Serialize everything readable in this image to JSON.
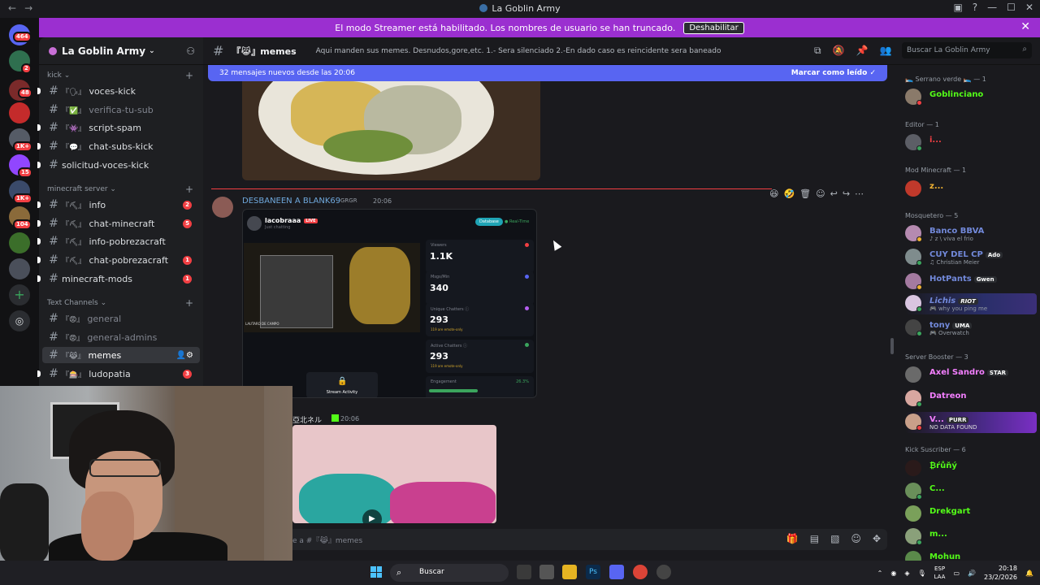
{
  "window": {
    "title": "La Goblin Army",
    "back_icon": "←",
    "forward_icon": "→"
  },
  "servers": {
    "badges": [
      "464",
      "2",
      "48",
      "1K+",
      "15",
      "1K+",
      "104"
    ]
  },
  "banner": {
    "text": "El modo Streamer está habilitado. Los nombres de usuario se han truncado.",
    "button": "Deshabilitar"
  },
  "sidebar": {
    "server_name": "La Goblin Army",
    "categories": {
      "kick": "kick",
      "minecraft": "minecraft server",
      "text": "Text Channels"
    },
    "channels": [
      {
        "emoji": "『🗣』",
        "label": "voces-kick",
        "count": ""
      },
      {
        "emoji": "『✅』",
        "label": "verifica-tu-sub",
        "count": ""
      },
      {
        "emoji": "『👾』",
        "label": "script-spam",
        "count": ""
      },
      {
        "emoji": "『💬』",
        "label": "chat-subs-kick",
        "count": ""
      },
      {
        "emoji": "",
        "label": "solicitud-voces-kick",
        "count": ""
      },
      {
        "emoji": "『⛏』",
        "label": "info",
        "count": "2"
      },
      {
        "emoji": "『⛏』",
        "label": "chat-minecraft",
        "count": "5"
      },
      {
        "emoji": "『⛏』",
        "label": "info-pobrezacraft",
        "count": ""
      },
      {
        "emoji": "『⛏』",
        "label": "chat-pobrezacraft",
        "count": "1"
      },
      {
        "emoji": "",
        "label": "minecraft-mods",
        "count": "1"
      },
      {
        "emoji": "『😡』",
        "label": "general",
        "count": ""
      },
      {
        "emoji": "『😡』",
        "label": "general-admins",
        "count": ""
      },
      {
        "emoji": "『😹』",
        "label": "memes",
        "count": ""
      },
      {
        "emoji": "『🎰』",
        "label": "ludopatia",
        "count": "3"
      }
    ]
  },
  "header": {
    "channel": "『😹』memes",
    "topic": "Aqui manden sus memes. Desnudos,gore,etc. 1.- Sera silenciado 2.-En dado caso es reincidente sera baneado",
    "search_placeholder": "Buscar La Goblin Army"
  },
  "chat": {
    "new_messages": "32 mensajes nuevos desde las 20:06",
    "mark_read": "Marcar como leído",
    "message1": {
      "author": "DESBANEEN A BLANK69",
      "tag": "GRGR",
      "time": "20:06"
    },
    "dashboard": {
      "username": "lacobraaa",
      "live": "LIVE",
      "status": "Just chatting",
      "pill1": "Database",
      "pill2": "● Real-Time",
      "video_caption": "LAUTARO DE CAMPO",
      "stats": [
        {
          "label": "Viewers",
          "value": "1.1K",
          "note": "",
          "color": "#f23f43"
        },
        {
          "label": "Msgs/Min",
          "value": "340",
          "note": "",
          "color": "#5865f2"
        },
        {
          "label": "Unique Chatters ⓘ",
          "value": "293",
          "note": "119 are emote-only",
          "color": "#b45ef0"
        },
        {
          "label": "Active Chatters ⓘ",
          "value": "293",
          "note": "119 are emote-only",
          "color": "#3ba55d"
        }
      ],
      "engagement_label": "Engagement",
      "engagement_value": "26.3%",
      "stream_activity": "Stream Activity"
    },
    "message2": {
      "author": "亞北ネル",
      "time": "20:06"
    },
    "composer_placeholder": "e a #『😹』memes"
  },
  "members": {
    "groups": [
      {
        "name": "🛌 Serrano verde 🛌 — 1"
      },
      {
        "name": "Editor — 1"
      },
      {
        "name": "Mod Minecraft — 1"
      },
      {
        "name": "Mosquetero — 5"
      },
      {
        "name": "Server Booster — 3"
      },
      {
        "name": "Kick Suscriber — 6"
      }
    ],
    "list": [
      {
        "name": "Goblinciano",
        "activity": "",
        "tag": "",
        "color": "#3ba55d"
      },
      {
        "name": "i...",
        "activity": "",
        "tag": "",
        "color": "#f23f43"
      },
      {
        "name": "z...",
        "activity": "",
        "tag": "",
        "color": "#f0b232"
      },
      {
        "name": "Banco BBVA",
        "activity": "♪ z \\ viva el frio",
        "tag": "",
        "color": "#5865f2"
      },
      {
        "name": "CUY DEL CP",
        "activity": "♫ Christian Meier",
        "tag": "Ado",
        "color": "#5865f2"
      },
      {
        "name": "HotPants",
        "activity": "",
        "tag": "Gwen",
        "color": "#5865f2"
      },
      {
        "name": "Lichis",
        "activity": "🎮 why you ping me",
        "tag": "RIOT",
        "color": "#5865f2"
      },
      {
        "name": "tony",
        "activity": "🎮 Overwatch",
        "tag": "UMA",
        "color": "#5865f2"
      },
      {
        "name": "Axel Sandro",
        "activity": "",
        "tag": "STAR",
        "color": "#f47fff"
      },
      {
        "name": "Datreon",
        "activity": "",
        "tag": "",
        "color": "#f47fff"
      },
      {
        "name": "V...",
        "activity": "NO DATA FOUND",
        "tag": "PURR",
        "color": "#f47fff"
      },
      {
        "name": "₿ŕůňý",
        "activity": "",
        "tag": "",
        "color": "#53fc18"
      },
      {
        "name": "C...",
        "activity": "",
        "tag": "",
        "color": "#53fc18"
      },
      {
        "name": "Drekgart",
        "activity": "",
        "tag": "",
        "color": "#53fc18"
      },
      {
        "name": "m...",
        "activity": "",
        "tag": "",
        "color": "#53fc18"
      },
      {
        "name": "Mohun",
        "activity": "",
        "tag": "",
        "color": "#53fc18"
      }
    ]
  },
  "taskbar": {
    "search": "Buscar",
    "lang": "ESP",
    "lang2": "LAA",
    "time": "20:18",
    "date": "23/2/2026"
  }
}
